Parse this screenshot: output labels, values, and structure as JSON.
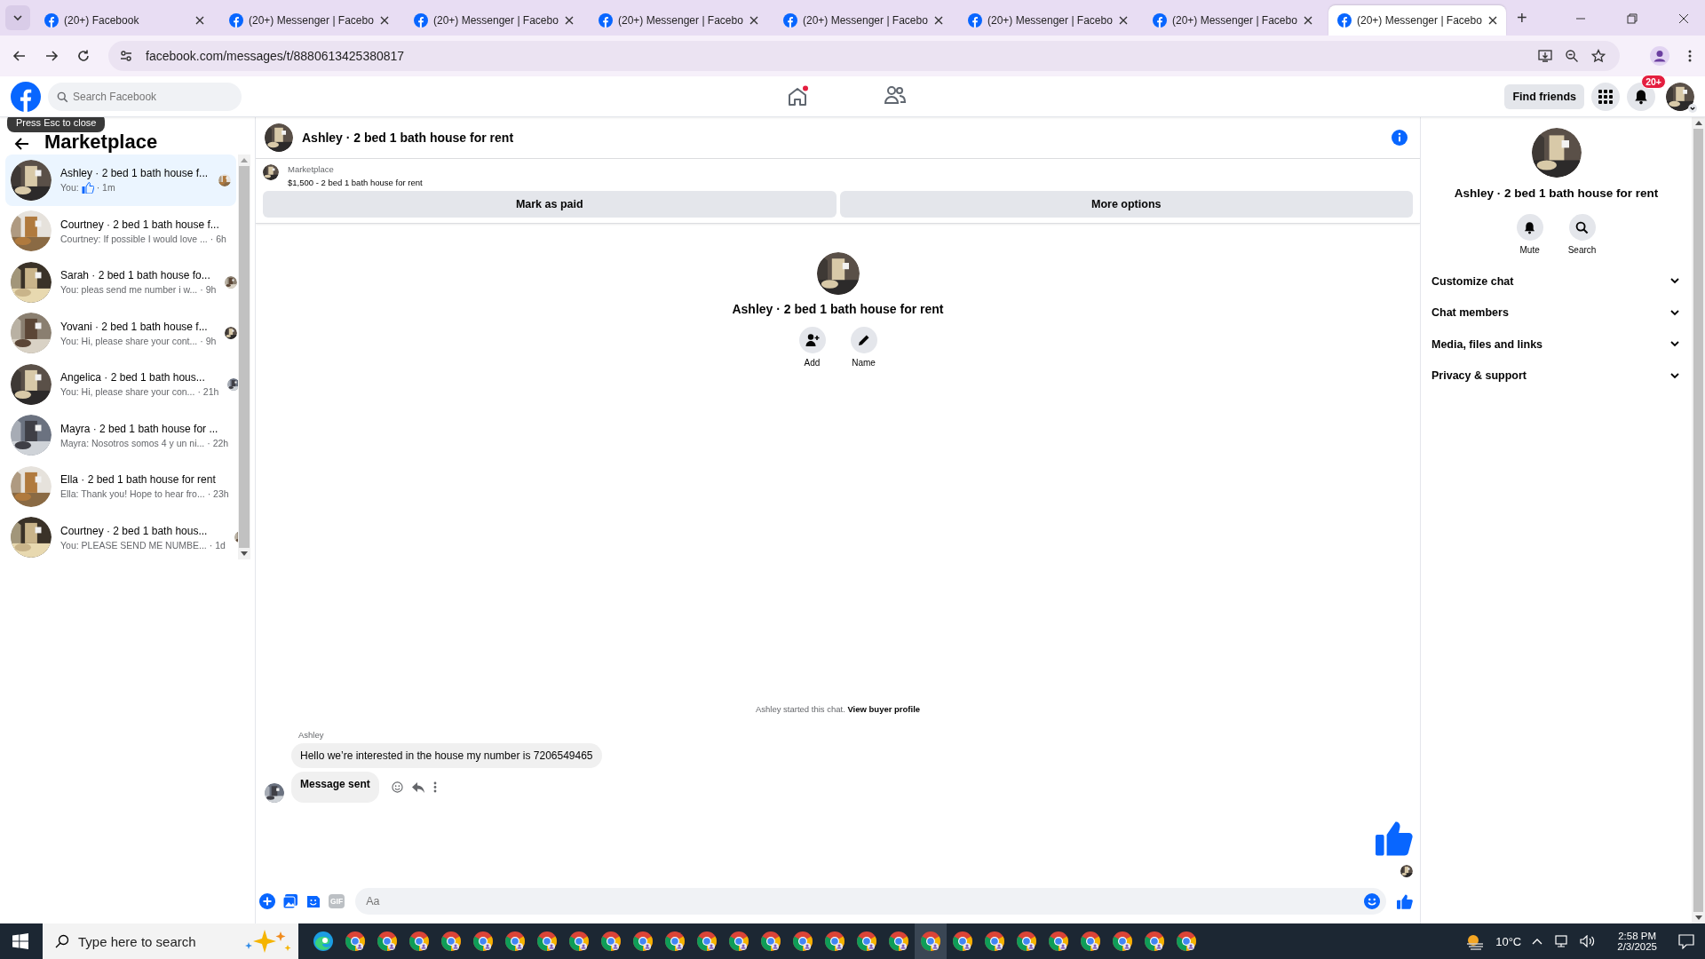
{
  "browser": {
    "tabs": [
      {
        "title": "(20+) Facebook",
        "selected": false
      },
      {
        "title": "(20+) Messenger | Facebo",
        "selected": false
      },
      {
        "title": "(20+) Messenger | Facebo",
        "selected": false
      },
      {
        "title": "(20+) Messenger | Facebo",
        "selected": false
      },
      {
        "title": "(20+) Messenger | Facebo",
        "selected": false
      },
      {
        "title": "(20+) Messenger | Facebo",
        "selected": false
      },
      {
        "title": "(20+) Messenger | Facebo",
        "selected": false
      },
      {
        "title": "(20+) Messenger | Facebo",
        "selected": true
      }
    ],
    "new_tab": "+",
    "url": "facebook.com/messages/t/8880613425380817"
  },
  "topbar": {
    "search_placeholder": "Search Facebook",
    "find_friends": "Find friends",
    "notification_count": "20+",
    "home_unread": true
  },
  "tooltip": "Press Esc to close",
  "sidebar": {
    "title": "Marketplace",
    "conversations": [
      {
        "title": "Ashley · 2 bed 1 bath house f...",
        "preview": "You:",
        "like": true,
        "time": "· 1m",
        "seen": true,
        "selected": true
      },
      {
        "title": "Courtney · 2 bed 1 bath house f...",
        "preview": "Courtney: If possible I would love ...",
        "like": false,
        "time": "· 6h",
        "seen": false,
        "selected": false
      },
      {
        "title": "Sarah · 2 bed 1 bath house fo...",
        "preview": "You: pleas send me number i w...",
        "like": false,
        "time": "· 9h",
        "seen": true,
        "selected": false
      },
      {
        "title": "Yovani · 2 bed 1 bath house f...",
        "preview": "You: Hi, please share your cont...",
        "like": false,
        "time": "· 9h",
        "seen": true,
        "selected": false
      },
      {
        "title": "Angelica · 2 bed 1 bath hous...",
        "preview": "You: Hi, please share your con...",
        "like": false,
        "time": "· 21h",
        "seen": true,
        "selected": false
      },
      {
        "title": "Mayra · 2 bed 1 bath house for ...",
        "preview": "Mayra: Nosotros somos 4 y un ni...",
        "like": false,
        "time": "· 22h",
        "seen": false,
        "selected": false
      },
      {
        "title": "Ella · 2 bed 1 bath house for rent",
        "preview": "Ella: Thank you! Hope to hear fro...",
        "like": false,
        "time": "· 23h",
        "seen": false,
        "selected": false
      },
      {
        "title": "Courtney · 2 bed 1 bath hous...",
        "preview": "You: PLEASE SEND ME NUMBE...",
        "like": false,
        "time": "· 1d",
        "seen": true,
        "selected": false
      }
    ]
  },
  "chat": {
    "title": "Ashley · 2 bed 1 bath house for rent",
    "listing": {
      "source": "Marketplace",
      "summary": "$1,500 - 2 bed 1 bath house for rent",
      "buttons": [
        "Mark as paid",
        "More options"
      ]
    },
    "intro": {
      "name": "Ashley · 2 bed 1 bath house for rent",
      "actions": [
        "Add",
        "Name"
      ]
    },
    "notice": "Ashley started this chat. **View buyer profile**",
    "sender": "Ashley",
    "messages": [
      {
        "text": "Hello we’re interested in the house my number is 7206549465",
        "bold": false
      },
      {
        "text": "Message sent",
        "bold": true
      }
    ],
    "composer": {
      "placeholder": "Aa",
      "gif_label": "GIF"
    }
  },
  "details": {
    "name": "Ashley · 2 bed 1 bath house for rent",
    "actions": [
      "Mute",
      "Search"
    ],
    "sections": [
      {
        "label": "Customize chat",
        "expanded": false
      },
      {
        "label": "Chat members",
        "expanded": false
      },
      {
        "label": "Media, files and links",
        "expanded": false
      },
      {
        "label": "Privacy & support",
        "expanded": false
      }
    ]
  },
  "taskbar": {
    "search_placeholder": "Type here to search",
    "apps": [
      {
        "kind": "edge",
        "selected": false
      },
      {
        "kind": "chrome",
        "selected": false
      },
      {
        "kind": "chrome",
        "selected": false
      },
      {
        "kind": "chrome",
        "selected": false
      },
      {
        "kind": "chrome",
        "selected": false
      },
      {
        "kind": "chrome",
        "selected": false
      },
      {
        "kind": "chrome",
        "selected": false
      },
      {
        "kind": "chrome",
        "selected": false
      },
      {
        "kind": "chrome",
        "selected": false
      },
      {
        "kind": "chrome",
        "selected": false
      },
      {
        "kind": "chrome",
        "selected": false
      },
      {
        "kind": "chrome",
        "selected": false
      },
      {
        "kind": "chrome",
        "selected": false
      },
      {
        "kind": "chrome",
        "selected": false
      },
      {
        "kind": "chrome",
        "selected": false
      },
      {
        "kind": "chrome",
        "selected": false
      },
      {
        "kind": "chrome",
        "selected": false
      },
      {
        "kind": "chrome",
        "selected": false
      },
      {
        "kind": "chrome",
        "selected": false
      },
      {
        "kind": "chrome",
        "selected": true
      },
      {
        "kind": "chrome",
        "selected": false
      },
      {
        "kind": "chrome",
        "selected": false
      },
      {
        "kind": "chrome",
        "selected": false
      },
      {
        "kind": "chrome",
        "selected": false
      },
      {
        "kind": "chrome",
        "selected": false
      },
      {
        "kind": "chrome",
        "selected": false
      },
      {
        "kind": "chrome",
        "selected": false
      },
      {
        "kind": "chrome",
        "selected": false
      }
    ],
    "temperature": "10°C",
    "time": "2:58 PM",
    "date": "2/3/2025"
  }
}
